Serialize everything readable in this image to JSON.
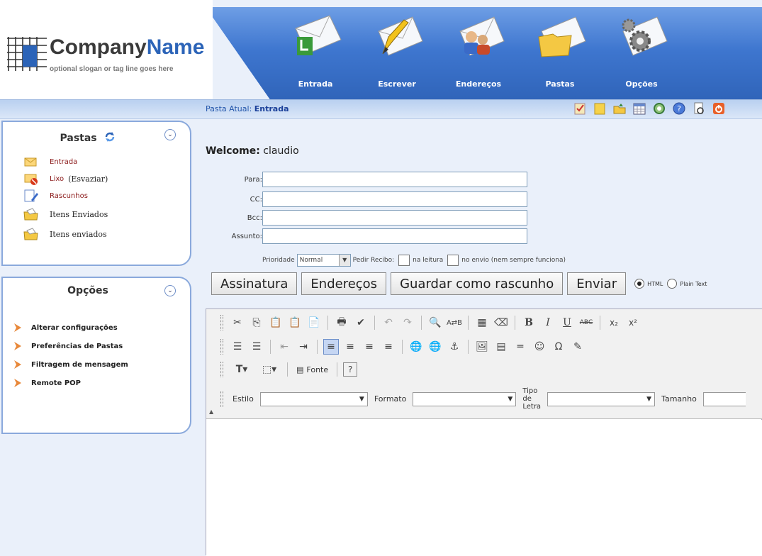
{
  "brand": {
    "company": "Company",
    "name": "Name",
    "slogan": "optional slogan or tag line goes here"
  },
  "nav": [
    {
      "label": "Entrada",
      "icon": "inbox-envelope-icon"
    },
    {
      "label": "Escrever",
      "icon": "compose-envelope-icon"
    },
    {
      "label": "Endereços",
      "icon": "addressbook-envelope-icon"
    },
    {
      "label": "Pastas",
      "icon": "folders-envelope-icon"
    },
    {
      "label": "Opções",
      "icon": "options-gears-icon"
    }
  ],
  "location": {
    "prefix": "Pasta Atual:",
    "current": "Entrada"
  },
  "toolbar_icons": [
    "tasks-icon",
    "notes-icon",
    "folder-up-icon",
    "calendar-icon",
    "search-icon",
    "help-icon",
    "print-preview-icon",
    "logout-icon"
  ],
  "folders": {
    "title": "Pastas",
    "items": [
      {
        "label": "Entrada",
        "type": "link",
        "icon": "inbox-icon"
      },
      {
        "label": "Lixo",
        "extra": "(Esvaziar)",
        "type": "link",
        "icon": "trash-icon"
      },
      {
        "label": "Rascunhos",
        "type": "link",
        "icon": "drafts-icon"
      },
      {
        "label": "Itens Enviados",
        "type": "plain",
        "icon": "sent-folder-icon"
      },
      {
        "label": "Itens enviados",
        "type": "plain",
        "icon": "sent-folder-icon"
      }
    ]
  },
  "options": {
    "title": "Opções",
    "items": [
      "Alterar configurações",
      "Preferências de Pastas",
      "Filtragem de mensagem",
      "Remote POP"
    ]
  },
  "compose": {
    "welcome_label": "Welcome:",
    "welcome_user": "claudio",
    "fields": [
      {
        "label": "Para:",
        "value": ""
      },
      {
        "label": "CC:",
        "value": ""
      },
      {
        "label": "Bcc:",
        "value": ""
      },
      {
        "label": "Assunto:",
        "value": ""
      }
    ],
    "priority_label": "Prioridade",
    "priority_value": "Normal",
    "receipt_label": "Pedir Recibo:",
    "receipt_read": "na leitura",
    "receipt_send": "no envio (nem sempre funciona)",
    "buttons": [
      "Assinatura",
      "Endereços",
      "Guardar como rascunho",
      "Enviar"
    ],
    "format_html": "HTML",
    "format_plain": "Plain Text"
  },
  "editor": {
    "fonte_label": "Fonte",
    "style_label": "Estilo",
    "format_label": "Formato",
    "font_label_1": "Tipo",
    "font_label_2": "de",
    "font_label_3": "Letra",
    "size_label": "Tamanho"
  },
  "colors": {
    "accent": "#2f63b8",
    "link": "#8b1a1a",
    "panel_border": "#8aa9dc"
  }
}
